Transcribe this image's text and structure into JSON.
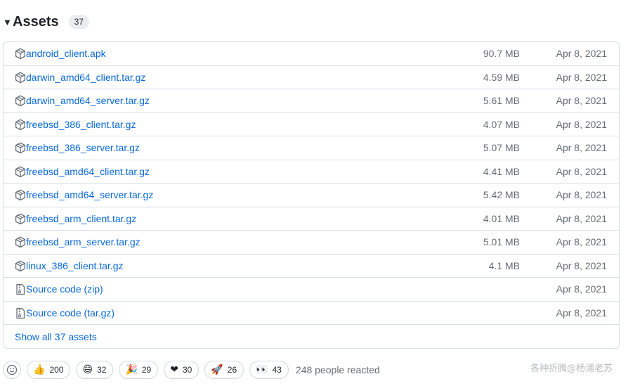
{
  "header": {
    "title": "Assets",
    "count": "37"
  },
  "assets": [
    {
      "name": "android_client.apk",
      "size": "90.7 MB",
      "date": "Apr 8, 2021",
      "icon": "package-icon"
    },
    {
      "name": "darwin_amd64_client.tar.gz",
      "size": "4.59 MB",
      "date": "Apr 8, 2021",
      "icon": "package-icon"
    },
    {
      "name": "darwin_amd64_server.tar.gz",
      "size": "5.61 MB",
      "date": "Apr 8, 2021",
      "icon": "package-icon"
    },
    {
      "name": "freebsd_386_client.tar.gz",
      "size": "4.07 MB",
      "date": "Apr 8, 2021",
      "icon": "package-icon"
    },
    {
      "name": "freebsd_386_server.tar.gz",
      "size": "5.07 MB",
      "date": "Apr 8, 2021",
      "icon": "package-icon"
    },
    {
      "name": "freebsd_amd64_client.tar.gz",
      "size": "4.41 MB",
      "date": "Apr 8, 2021",
      "icon": "package-icon"
    },
    {
      "name": "freebsd_amd64_server.tar.gz",
      "size": "5.42 MB",
      "date": "Apr 8, 2021",
      "icon": "package-icon"
    },
    {
      "name": "freebsd_arm_client.tar.gz",
      "size": "4.01 MB",
      "date": "Apr 8, 2021",
      "icon": "package-icon"
    },
    {
      "name": "freebsd_arm_server.tar.gz",
      "size": "5.01 MB",
      "date": "Apr 8, 2021",
      "icon": "package-icon"
    },
    {
      "name": "linux_386_client.tar.gz",
      "size": "4.1 MB",
      "date": "Apr 8, 2021",
      "icon": "package-icon"
    }
  ],
  "source_code": [
    {
      "name": "Source code",
      "suffix": "(zip)",
      "date": "Apr 8, 2021",
      "icon": "file-zip-icon"
    },
    {
      "name": "Source code",
      "suffix": "(tar.gz)",
      "date": "Apr 8, 2021",
      "icon": "file-zip-icon"
    }
  ],
  "show_all": "Show all 37 assets",
  "reactions": [
    {
      "emoji": "👍",
      "icon": "thumbs-up-icon",
      "count": "200"
    },
    {
      "emoji": "😄",
      "icon": "laugh-icon",
      "count": "32"
    },
    {
      "emoji": "🎉",
      "icon": "hooray-icon",
      "count": "29"
    },
    {
      "emoji": "❤",
      "icon": "heart-icon",
      "count": "30"
    },
    {
      "emoji": "🚀",
      "icon": "rocket-icon",
      "count": "26"
    },
    {
      "emoji": "👀",
      "icon": "eyes-icon",
      "count": "43"
    }
  ],
  "reacted_text": "248 people reacted",
  "watermark": "各种折腾@杨浦老苏",
  "colors": {
    "link": "#0969da",
    "muted": "#656d76",
    "border": "#d8dee4"
  }
}
